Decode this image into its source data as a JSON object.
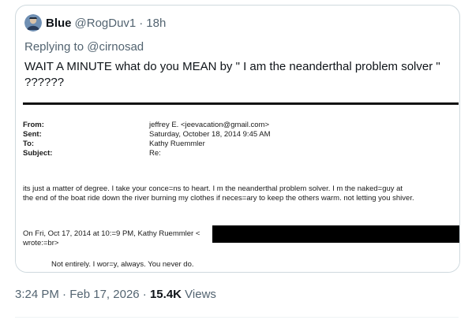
{
  "quoted_tweet": {
    "author_name": "Blue",
    "author_handle": "@RogDuv1",
    "separator": "·",
    "relative_time": "18h",
    "replying_to_prefix": "Replying to",
    "replying_to_handle": "@cirnosad",
    "text": "WAIT A MINUTE what do you MEAN by \" I am the neanderthal problem solver \" ??????",
    "avatar_icon": "avatar-icon"
  },
  "email_image": {
    "headers": [
      {
        "label": "From:",
        "value": "jeffrey E. <jeevacation@gmail.com>"
      },
      {
        "label": "Sent:",
        "value": "Saturday, October 18, 2014 9:45 AM"
      },
      {
        "label": "To:",
        "value": "Kathy Ruemmler"
      },
      {
        "label": "Subject:",
        "value": "Re:"
      }
    ],
    "body_line_1": "its just a matter of degree.  I take your conce=ns to heart.  I m the neanderthal problem solver.  I m the naked=guy at",
    "body_line_2": "the end of the boat ride down the river burning my clothes if neces=ary to keep the others warm. not letting you shiver.",
    "quote_intro_1": "On Fri, Oct 17, 2014 at 10:=9 PM, Kathy Ruemmler <",
    "quote_intro_2": "wrote:=br>",
    "quoted_reply": "Not entirely.  I wor=y, always.  You never do."
  },
  "footer": {
    "time": "3:24 PM",
    "separator_1": "·",
    "date": "Feb 17, 2026",
    "separator_2": "·",
    "views_count": "15.4K",
    "views_label": "Views"
  },
  "colors": {
    "text_primary": "#0f1419",
    "text_secondary": "#536471",
    "border": "#cfd9de",
    "redaction": "#000000"
  }
}
